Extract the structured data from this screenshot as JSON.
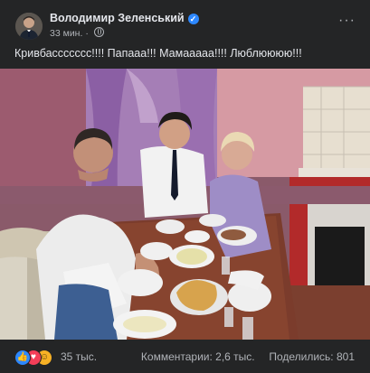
{
  "post": {
    "author": "Володимир Зеленський",
    "time": "33 мин.",
    "separator": "·",
    "text": "Кривбассссссс!!!! Папааа!!! Мамааааа!!!! Люблюююю!!!",
    "more_label": "···"
  },
  "icons": {
    "verified": "verified-badge-icon",
    "audience": "globe-icon",
    "reactions": [
      "like-icon",
      "love-icon",
      "haha-icon"
    ]
  },
  "reactions": {
    "count": "35 тыс."
  },
  "stats": {
    "comments": "Комментарии: 2,6 тыс.",
    "shares": "Поделились: 801"
  },
  "colors": {
    "background": "#242526",
    "text_primary": "#e4e6eb",
    "text_secondary": "#b0b3b8",
    "verified": "#2d88ff",
    "like": "#2d88ff",
    "love": "#f33e58",
    "haha": "#f7b125"
  }
}
